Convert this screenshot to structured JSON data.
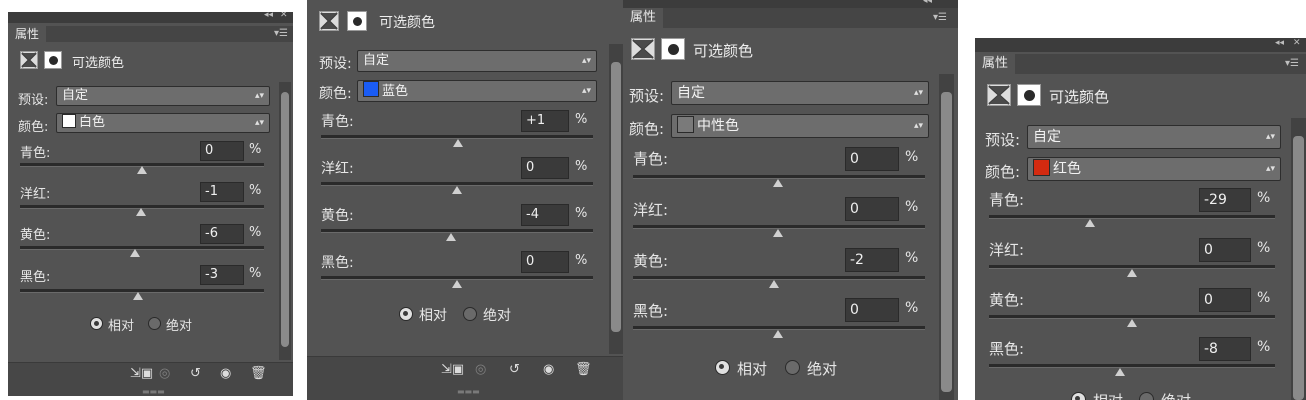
{
  "labels": {
    "properties_tab": "属性",
    "adjust_title": "可选颜色",
    "preset_label": "预设:",
    "color_label": "颜色:",
    "cyan": "青色:",
    "magenta": "洋红:",
    "yellow": "黄色:",
    "black": "黑色:",
    "percent": "%",
    "relative": "相对",
    "absolute": "绝对"
  },
  "panels": [
    {
      "preset": "自定",
      "color_name": "白色",
      "swatch": "#ffffff",
      "values": {
        "cyan": "0",
        "magenta": "-1",
        "yellow": "-6",
        "black": "-3"
      },
      "method": "relative"
    },
    {
      "preset": "自定",
      "color_name": "蓝色",
      "swatch": "#1a5cf5",
      "values": {
        "cyan": "+1",
        "magenta": "0",
        "yellow": "-4",
        "black": "0"
      },
      "method": "relative"
    },
    {
      "preset": "自定",
      "color_name": "中性色",
      "swatch": "#7a7a7a",
      "values": {
        "cyan": "0",
        "magenta": "0",
        "yellow": "-2",
        "black": "0"
      },
      "method": "relative"
    },
    {
      "preset": "自定",
      "color_name": "红色",
      "swatch": "#d42a10",
      "values": {
        "cyan": "-29",
        "magenta": "0",
        "yellow": "0",
        "black": "-8"
      },
      "method": "relative"
    }
  ],
  "icons": {
    "collapse": "double-chevron-left-icon",
    "close": "close-icon",
    "panel_menu": "panel-menu-icon",
    "adjustment": "selective-color-icon",
    "mask": "layer-mask-icon",
    "clip": "clip-to-layer-icon",
    "view_previous": "view-previous-state-icon",
    "reset": "reset-icon",
    "visibility": "eye-icon",
    "delete": "trash-icon"
  }
}
